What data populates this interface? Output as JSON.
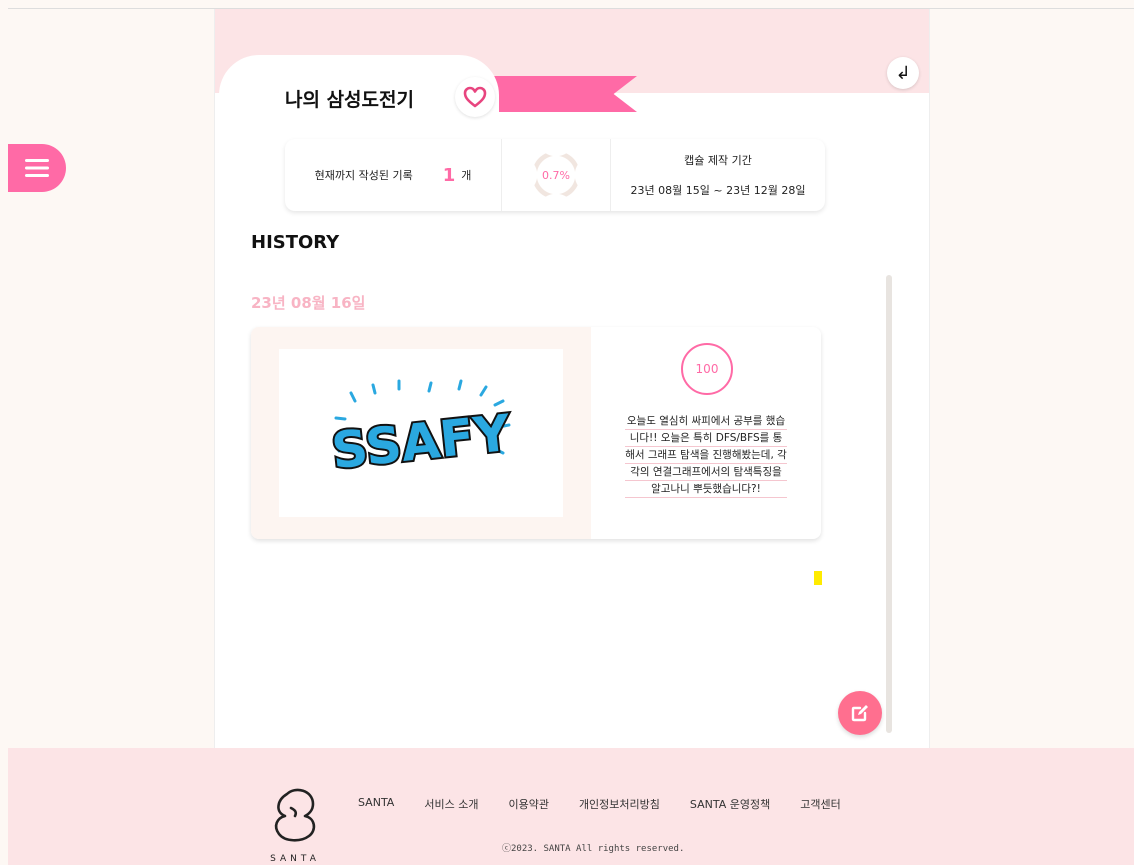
{
  "header": {
    "title": "나의 삼성도전기",
    "heart_icon": "heart-outline-icon",
    "back_icon": "back-arrow-icon",
    "back_glyph": "↲"
  },
  "stats": {
    "count_label": "현재까지 작성된 기록",
    "count_value": "1",
    "count_unit": "개",
    "progress_text": "0.7%",
    "progress": 0.007,
    "period_label": "캡슐 제작 기간",
    "period_value": "23년 08월 15일 ~ 23년 12월 28일"
  },
  "history": {
    "title": "HISTORY",
    "entries": [
      {
        "date": "23년 08월 16일",
        "image_text": "SSAFY",
        "sticker_text": "100",
        "body": "오늘도 열심히 싸피에서 공부를 했습니다!! 오늘은 특히 DFS/BFS를 통해서 그래프 탐색을 진행해봤는데, 각각의 연결그래프에서의 탐색특징을 알고나니 뿌듯했습니다?!"
      }
    ]
  },
  "actions": {
    "menu_icon": "hamburger-menu-icon",
    "write_icon": "edit-icon"
  },
  "footer": {
    "logo_word": "SANTA",
    "links": [
      "SANTA",
      "서비스 소개",
      "이용약관",
      "개인정보처리방침",
      "SANTA 운영정책",
      "고객센터"
    ],
    "copyright": "ⓒ2023. SANTA All rights reserved."
  },
  "colors": {
    "accent": "#ff6aa6",
    "header_bg": "#fce4e6",
    "page_bg": "#fdf8f4",
    "date_color": "#f8b4c4"
  }
}
